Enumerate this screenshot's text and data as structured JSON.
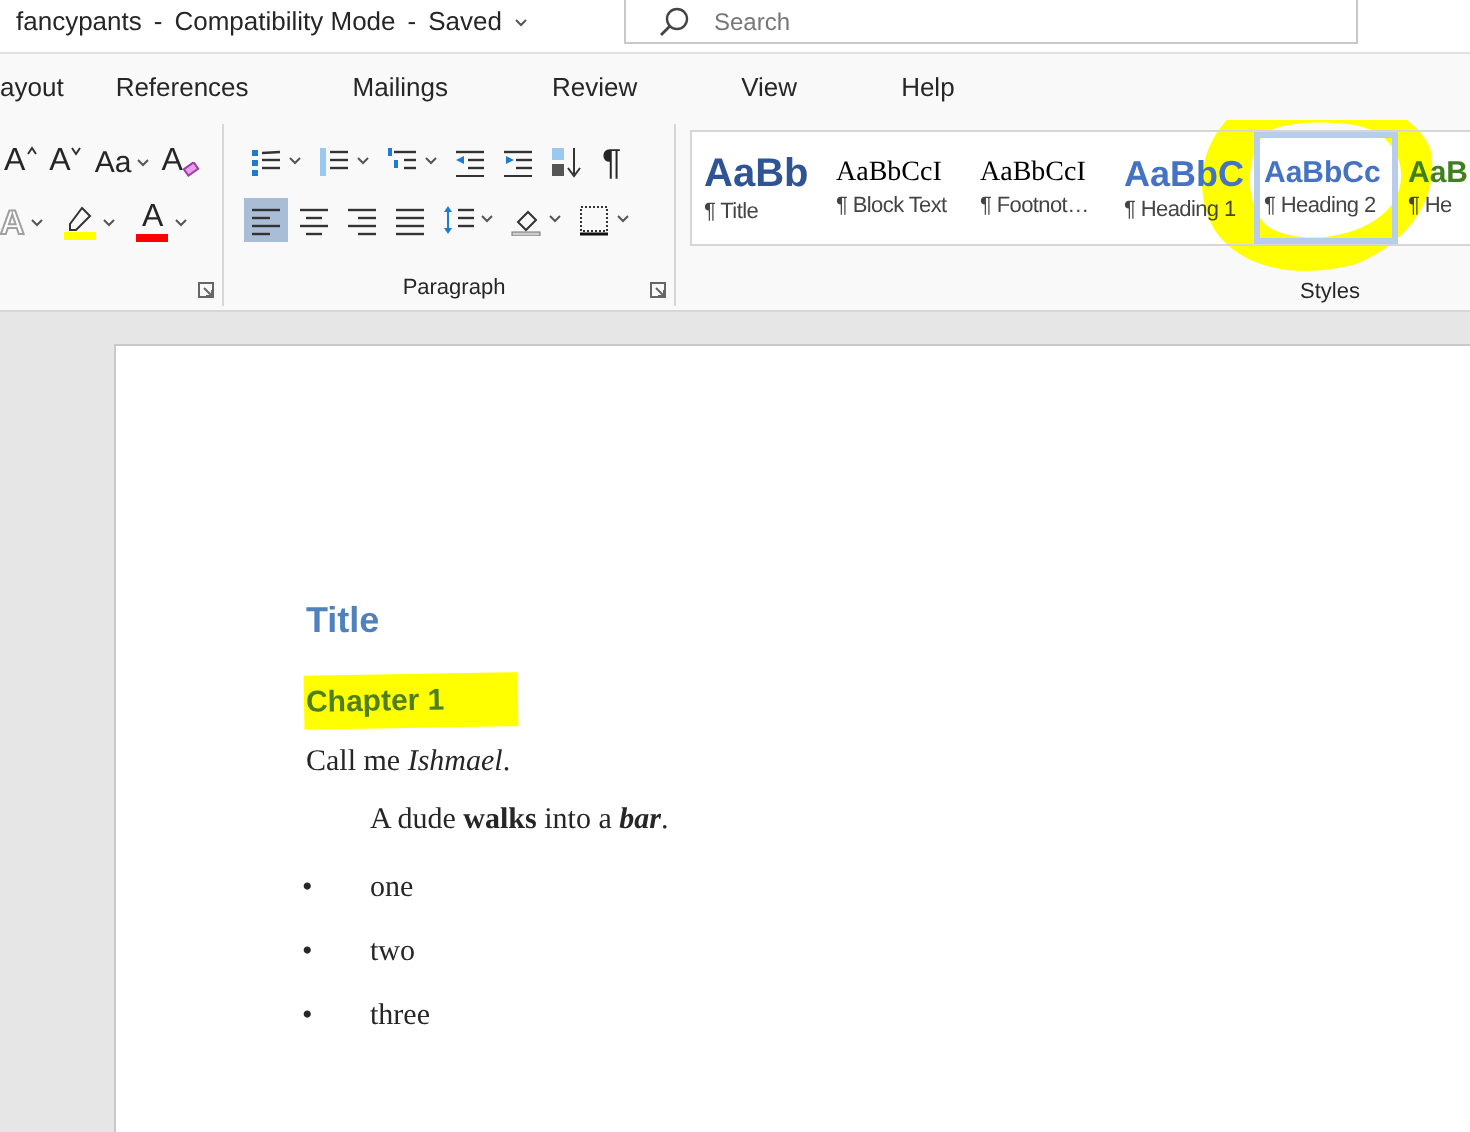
{
  "title_bar": {
    "document_title": "fancypants",
    "separator": "-",
    "mode": "Compatibility Mode",
    "save_state": "Saved",
    "search": {
      "placeholder": "Search"
    }
  },
  "tabs": [
    {
      "label": "ayout",
      "selected": false
    },
    {
      "label": "References",
      "selected": false
    },
    {
      "label": "Mailings",
      "selected": false
    },
    {
      "label": "Review",
      "selected": false
    },
    {
      "label": "View",
      "selected": false
    },
    {
      "label": "Help",
      "selected": false
    }
  ],
  "font_group": {
    "tools": [
      {
        "kind": "grow_font",
        "label": "A"
      },
      {
        "kind": "shrink_font",
        "label": "A"
      },
      {
        "kind": "change_case",
        "label": "Aa"
      },
      {
        "kind": "clear_formatting",
        "label": "A"
      },
      {
        "kind": "text_effects",
        "label": "A"
      },
      {
        "kind": "highlight",
        "color": "#ffff00"
      },
      {
        "kind": "font_color",
        "label": "A",
        "color": "#ff0000"
      }
    ]
  },
  "paragraph_group": {
    "label": "Paragraph",
    "tools": [
      {
        "kind": "bullets",
        "selected": false
      },
      {
        "kind": "numbering",
        "selected": false
      },
      {
        "kind": "multilevel",
        "selected": false
      },
      {
        "kind": "decrease_indent",
        "selected": false
      },
      {
        "kind": "increase_indent",
        "selected": false
      },
      {
        "kind": "sort",
        "selected": false
      },
      {
        "kind": "show_marks",
        "label": "¶",
        "selected": false
      },
      {
        "kind": "align_left",
        "selected": true
      },
      {
        "kind": "center",
        "selected": false
      },
      {
        "kind": "align_right",
        "selected": false
      },
      {
        "kind": "justify",
        "selected": false
      },
      {
        "kind": "line_spacing",
        "selected": false
      },
      {
        "kind": "shading",
        "selected": false
      },
      {
        "kind": "borders",
        "selected": false
      }
    ]
  },
  "styles_group": {
    "label": "Styles",
    "circled": true,
    "styles": [
      {
        "kind": "title",
        "preview": "AaBb",
        "label": "¶ Title",
        "selected": false
      },
      {
        "kind": "serif",
        "preview": "AaBbCcI",
        "label": "¶ Block Text",
        "selected": false
      },
      {
        "kind": "serif",
        "preview": "AaBbCcI",
        "label": "¶ Footnot…",
        "selected": false
      },
      {
        "kind": "heading1",
        "preview": "AaBbC",
        "label": "¶ Heading 1",
        "selected": false
      },
      {
        "kind": "heading2",
        "preview": "AaBbCc",
        "label": "¶ Heading 2",
        "selected": true
      },
      {
        "kind": "heading3",
        "preview": "AaB",
        "label": "¶ He",
        "selected": false
      }
    ]
  },
  "document": [
    {
      "kind": "title",
      "text": "Title"
    },
    {
      "kind": "heading",
      "text": "Chapter 1",
      "highlighted": true
    },
    {
      "kind": "body",
      "text": "Call me *Ishmael*."
    },
    {
      "kind": "quote",
      "runs": [
        {
          "text": "A dude ",
          "bold": false,
          "italic": false
        },
        {
          "text": "walks",
          "bold": true,
          "italic": false
        },
        {
          "text": " into a ",
          "bold": false,
          "italic": false
        },
        {
          "text": "bar",
          "bold": true,
          "italic": true
        },
        {
          "text": ".",
          "bold": false,
          "italic": false
        }
      ]
    },
    {
      "kind": "bullet",
      "bullet": "•",
      "text": "one"
    },
    {
      "kind": "bullet",
      "bullet": "•",
      "text": "two"
    },
    {
      "kind": "bullet",
      "bullet": "•",
      "text": "three"
    }
  ]
}
